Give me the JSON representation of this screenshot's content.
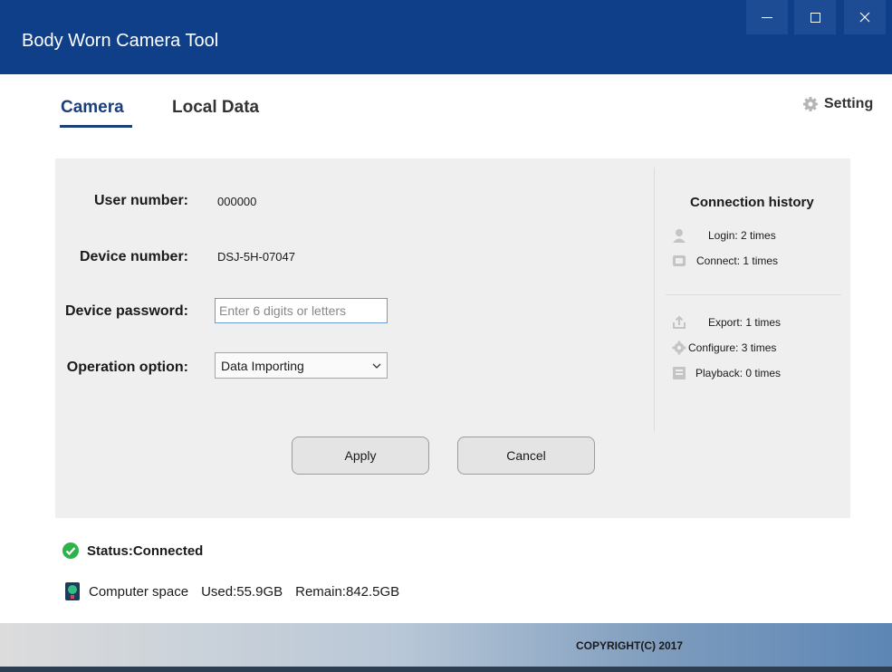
{
  "app": {
    "title": "Body Worn Camera Tool"
  },
  "tabs": [
    {
      "label": "Camera",
      "active": true
    },
    {
      "label": "Local Data",
      "active": false
    }
  ],
  "setting": {
    "label": "Setting",
    "icon": "gear-icon"
  },
  "form": {
    "user_number_label": "User number:",
    "user_number_value": "000000",
    "device_number_label": "Device number:",
    "device_number_value": "DSJ-5H-07047",
    "password_label": "Device password:",
    "password_placeholder": "Enter 6 digits or letters",
    "operation_label": "Operation option:",
    "operation_value": "Data Importing"
  },
  "buttons": {
    "apply": "Apply",
    "cancel": "Cancel"
  },
  "history": {
    "title": "Connection history",
    "items": [
      {
        "icon": "user-icon",
        "label": "Login: 2 times"
      },
      {
        "icon": "connect-icon",
        "label": "Connect: 1 times"
      },
      {
        "icon": "export-icon",
        "label": "Export: 1 times"
      },
      {
        "icon": "gear-icon",
        "label": "Configure: 3 times"
      },
      {
        "icon": "playback-icon",
        "label": "Playback: 0 times"
      }
    ]
  },
  "status": {
    "text": "Status:Connected",
    "color": "#2cb34a"
  },
  "space": {
    "label": "Computer space",
    "used": "Used:55.9GB",
    "remain": "Remain:842.5GB"
  },
  "footer": {
    "copyright": "COPYRIGHT(C) 2017"
  },
  "colors": {
    "titlebar": "#0f3f88",
    "accent": "#1b3f7a"
  }
}
